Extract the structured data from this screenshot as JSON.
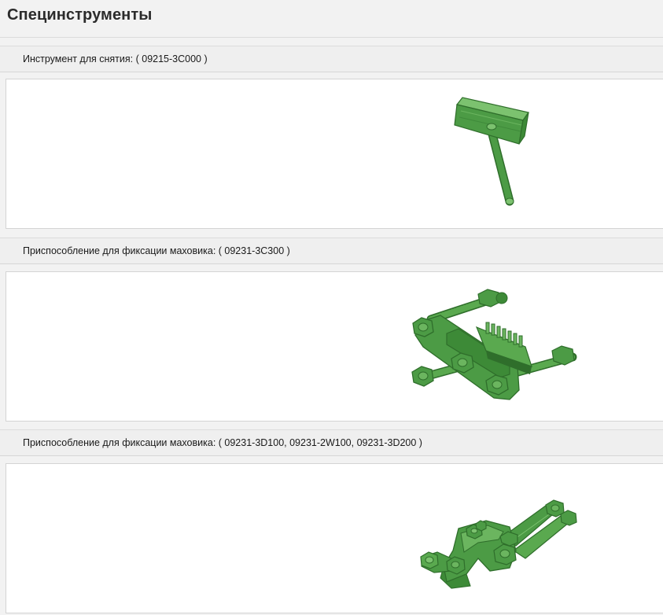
{
  "page": {
    "title": "Специнструменты"
  },
  "tools": [
    {
      "label": "Инструмент для снятия: ( 09215-3C000 )",
      "icon": "puller-tool-icon"
    },
    {
      "label": "Приспособление для фиксации маховика: ( 09231-3C300 )",
      "icon": "flywheel-lock-icon"
    },
    {
      "label": "Приспособление для фиксации маховика: ( 09231-3D100, 09231-2W100, 09231-3D200 )",
      "icon": "flywheel-bracket-icon"
    }
  ],
  "colors": {
    "tool_green": "#4c9b45",
    "tool_dark": "#2f6e2b",
    "tool_light": "#7cc26f"
  }
}
